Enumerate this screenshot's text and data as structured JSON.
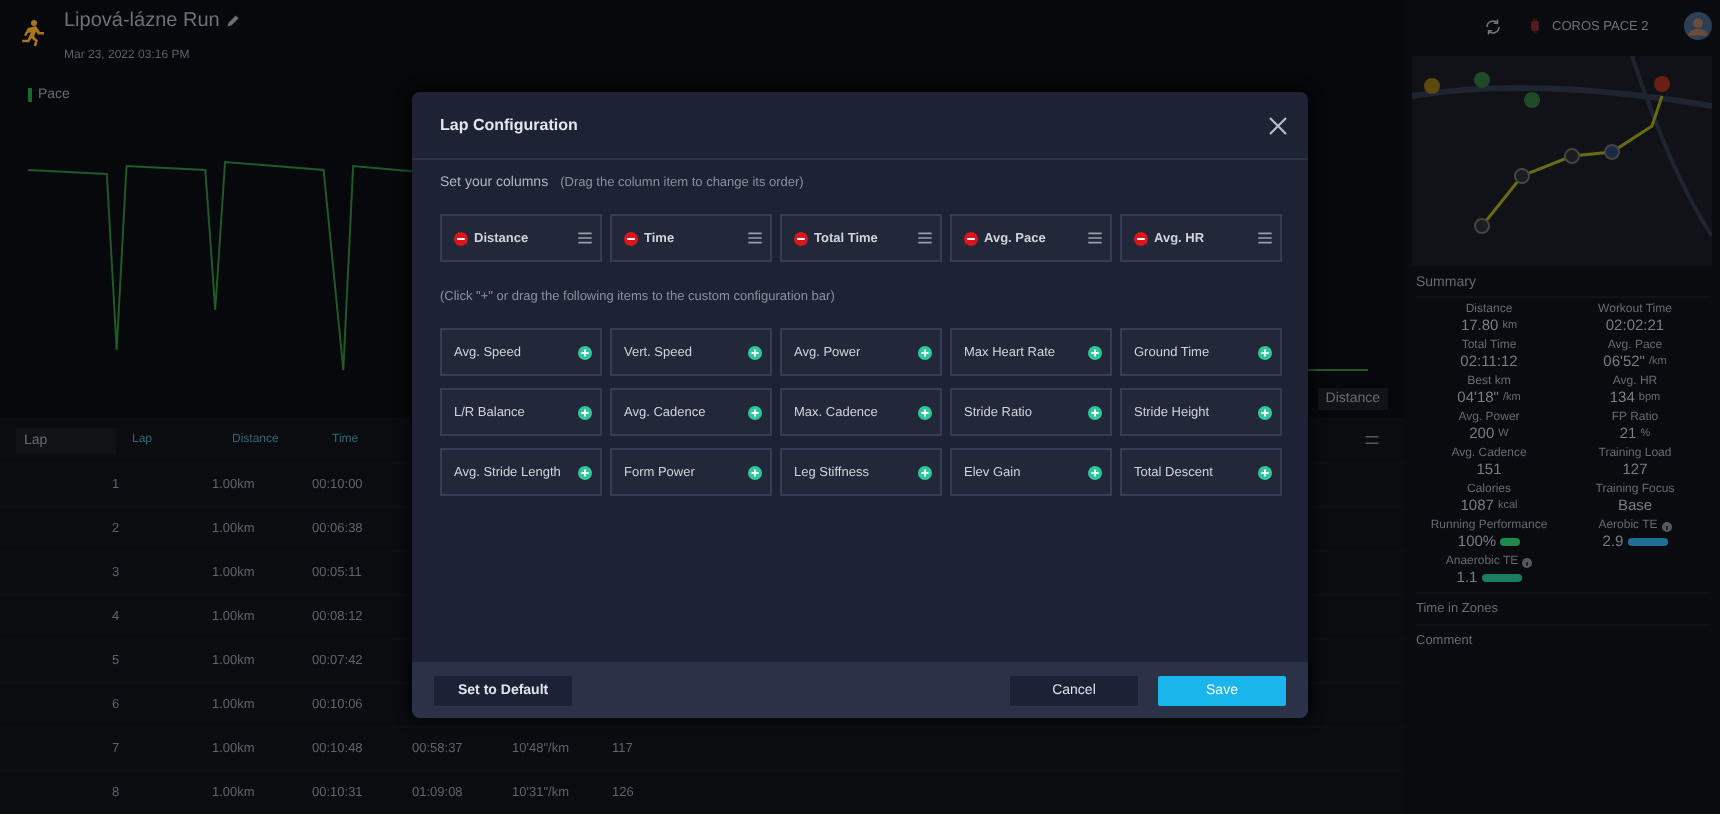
{
  "activity": {
    "title": "Lipová-lázne Run",
    "date": "Mar 23, 2022 03:16 PM"
  },
  "chart": {
    "legend": "Pace",
    "toggle": "Distance"
  },
  "lap_table": {
    "selector": "Lap",
    "columns": [
      "Lap",
      "Distance",
      "Time"
    ],
    "rows": [
      {
        "cells": [
          "1",
          "1.00km",
          "00:10:00"
        ]
      },
      {
        "cells": [
          "2",
          "1.00km",
          "00:06:38"
        ]
      },
      {
        "cells": [
          "3",
          "1.00km",
          "00:05:11"
        ]
      },
      {
        "cells": [
          "4",
          "1.00km",
          "00:08:12"
        ]
      },
      {
        "cells": [
          "5",
          "1.00km",
          "00:07:42"
        ]
      },
      {
        "cells": [
          "6",
          "1.00km",
          "00:10:06"
        ]
      },
      {
        "cells": [
          "7",
          "1.00km",
          "00:10:48",
          "00:58:37",
          "10'48\"/km",
          "117"
        ]
      },
      {
        "cells": [
          "8",
          "1.00km",
          "00:10:31",
          "01:09:08",
          "10'31\"/km",
          "126"
        ]
      }
    ]
  },
  "device": "COROS PACE 2",
  "summary": {
    "title": "Summary",
    "items": [
      {
        "label": "Distance",
        "value": "17.80",
        "unit": "km",
        "kind": "text"
      },
      {
        "label": "Workout Time",
        "value": "02:02:21",
        "kind": "text"
      },
      {
        "label": "Total Time",
        "value": "02:11:12",
        "kind": "text"
      },
      {
        "label": "Avg. Pace",
        "value": "06'52\"",
        "unit": "/km",
        "kind": "text"
      },
      {
        "label": "Best km",
        "value": "04'18\"",
        "unit": "/km",
        "kind": "text"
      },
      {
        "label": "Avg. HR",
        "value": "134",
        "unit": "bpm",
        "kind": "text"
      },
      {
        "label": "Avg. Power",
        "value": "200",
        "unit": "W",
        "kind": "text"
      },
      {
        "label": "FP Ratio",
        "value": "21",
        "unit": "%",
        "kind": "text"
      },
      {
        "label": "Avg. Cadence",
        "value": "151",
        "kind": "text"
      },
      {
        "label": "Training Load",
        "value": "127",
        "kind": "text"
      },
      {
        "label": "Calories",
        "value": "1087",
        "unit": "kcal",
        "kind": "text"
      },
      {
        "label": "Training Focus",
        "value": "Base",
        "kind": "text"
      },
      {
        "label": "Running Performance",
        "value": "100%",
        "kind": "pill",
        "color": "#1f8a4c"
      },
      {
        "label": "Aerobic TE",
        "value": "2.9",
        "kind": "bar",
        "color": "#1d6f93",
        "info": true
      },
      {
        "label": "Anaerobic TE",
        "value": "1.1",
        "kind": "bar",
        "color": "#1a7d62",
        "info": true
      }
    ]
  },
  "sections": [
    "Time in Zones",
    "Comment"
  ],
  "modal": {
    "title": "Lap Configuration",
    "set_heading": "Set your columns",
    "set_hint": "(Drag the column item to change its order)",
    "columns": [
      "Distance",
      "Time",
      "Total Time",
      "Avg. Pace",
      "Avg. HR"
    ],
    "add_hint": "(Click \"+\" or drag the following items to the custom configuration bar)",
    "available": [
      "Avg. Speed",
      "Vert. Speed",
      "Avg. Power",
      "Max Heart Rate",
      "Ground Time",
      "L/R Balance",
      "Avg. Cadence",
      "Max. Cadence",
      "Stride Ratio",
      "Stride Height",
      "Avg. Stride Length",
      "Form Power",
      "Leg Stiffness",
      "Elev Gain",
      "Total Descent"
    ],
    "default_button": "Set to Default",
    "cancel_button": "Cancel",
    "save_button": "Save"
  }
}
